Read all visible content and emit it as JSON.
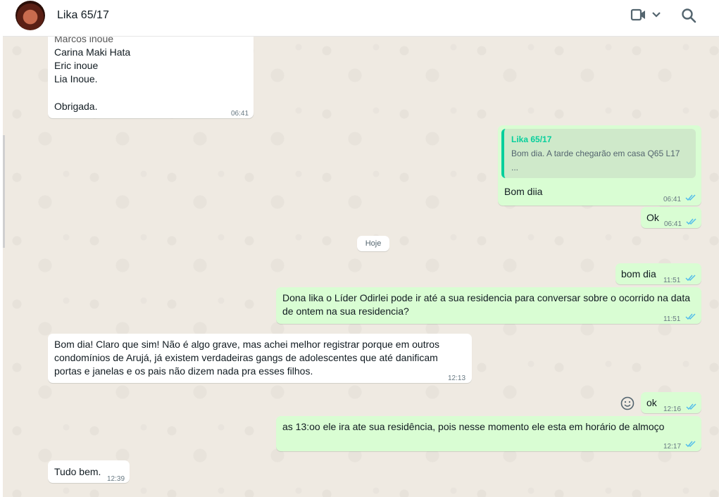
{
  "header": {
    "contact_name": "Lika 65/17"
  },
  "messages": {
    "m1": {
      "lines": [
        "Marcos inoue",
        "Carina Maki Hata",
        "Eric inoue",
        "Lia Inoue.",
        "",
        "Obrigada."
      ],
      "time": "06:41"
    },
    "m2": {
      "quote_author": "Lika 65/17",
      "quote_line1": "Bom dia. A tarde chegarão em casa Q65 L17",
      "quote_line2": "...",
      "text": "Bom diia",
      "time": "06:41"
    },
    "m3": {
      "text": "Ok",
      "time": "06:41"
    },
    "date_divider": "Hoje",
    "m4": {
      "text": "bom dia",
      "time": "11:51"
    },
    "m5": {
      "line1": "Dona lika o Líder Odirlei pode ir até a sua residencia para conversar sobre o ocorrido na data",
      "line2": "de ontem na sua residencia?",
      "time": "11:51"
    },
    "m6": {
      "line1": "Bom dia! Claro que sim! Não é algo grave, mas achei melhor registrar porque em outros",
      "line2": "condomínios de Arujá, já existem verdadeiras gangs de adolescentes que até danificam",
      "line3": "portas e janelas e os pais não dizem nada pra esses filhos.",
      "time": "12:13"
    },
    "m7": {
      "text": "ok",
      "time": "12:16"
    },
    "m8": {
      "text": "as 13:oo ele ira ate sua residência, pois nesse momento ele esta em horário de almoço",
      "time": "12:17"
    },
    "m9": {
      "text": "Tudo bem.",
      "time": "12:39"
    }
  },
  "colors": {
    "incoming_bg": "#ffffff",
    "outgoing_bg": "#d9fdd3",
    "read_tick": "#53bdeb",
    "chat_bg": "#efeae2",
    "quote_accent": "#06cf9c"
  },
  "icons": {
    "video": "video-camera-icon",
    "chevron": "chevron-down-icon",
    "search": "search-icon",
    "emoji": "smiley-icon",
    "ticks": "double-check-icon"
  }
}
